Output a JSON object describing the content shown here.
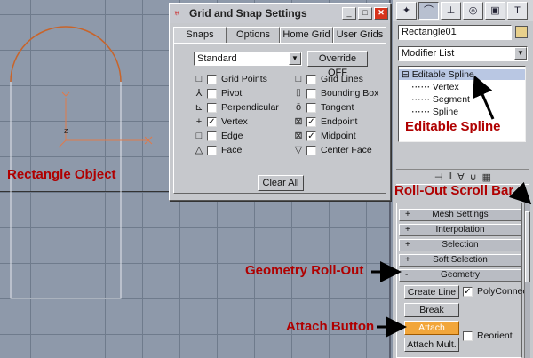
{
  "viewport": {
    "annotation_rectangle": "Rectangle Object",
    "axis_label_z": "z"
  },
  "dialog": {
    "title": "Grid and Snap Settings",
    "tabs": [
      "Snaps",
      "Options",
      "Home Grid",
      "User Grids"
    ],
    "snap_type": "Standard",
    "override_button": "Override OFF",
    "snaps_left": [
      {
        "icon": "□",
        "label": "Grid Points",
        "checked": false
      },
      {
        "icon": "⅄",
        "label": "Pivot",
        "checked": false
      },
      {
        "icon": "⊾",
        "label": "Perpendicular",
        "checked": false
      },
      {
        "icon": "+",
        "label": "Vertex",
        "checked": true
      },
      {
        "icon": "□",
        "label": "Edge",
        "checked": false
      },
      {
        "icon": "△",
        "label": "Face",
        "checked": false
      }
    ],
    "snaps_right": [
      {
        "icon": "□",
        "label": "Grid Lines",
        "checked": false
      },
      {
        "icon": "⌷",
        "label": "Bounding Box",
        "checked": false
      },
      {
        "icon": "ō",
        "label": "Tangent",
        "checked": false
      },
      {
        "icon": "⊠",
        "label": "Endpoint",
        "checked": true
      },
      {
        "icon": "⊠",
        "label": "Midpoint",
        "checked": true
      },
      {
        "icon": "▽",
        "label": "Center Face",
        "checked": false
      }
    ],
    "clear_all_button": "Clear All"
  },
  "panel": {
    "object_name": "Rectangle01",
    "modifier_list": "Modifier List",
    "stack": {
      "root": "Editable Spline",
      "children": [
        "Vertex",
        "Segment",
        "Spline"
      ]
    },
    "rollouts": [
      {
        "sign": "+",
        "label": "Mesh Settings"
      },
      {
        "sign": "+",
        "label": "Interpolation"
      },
      {
        "sign": "+",
        "label": "Selection"
      },
      {
        "sign": "+",
        "label": "Soft Selection"
      },
      {
        "sign": "-",
        "label": "Geometry"
      }
    ],
    "geometry": {
      "create_line": "Create Line",
      "polyconnect": "PolyConnect",
      "break": "Break",
      "attach": "Attach",
      "reorient": "Reorient",
      "attach_mult": "Attach Mult."
    }
  },
  "annotations": {
    "editable_spline": "Editable Spline",
    "rollout_scroll_bar": "Roll-Out Scroll Bar",
    "geometry_rollout": "Geometry Roll-Out",
    "attach_button": "Attach Button"
  },
  "colors": {
    "annotation_red": "#b00000",
    "attach_highlight": "#f2a63a",
    "spline_orange": "#c8642a"
  }
}
